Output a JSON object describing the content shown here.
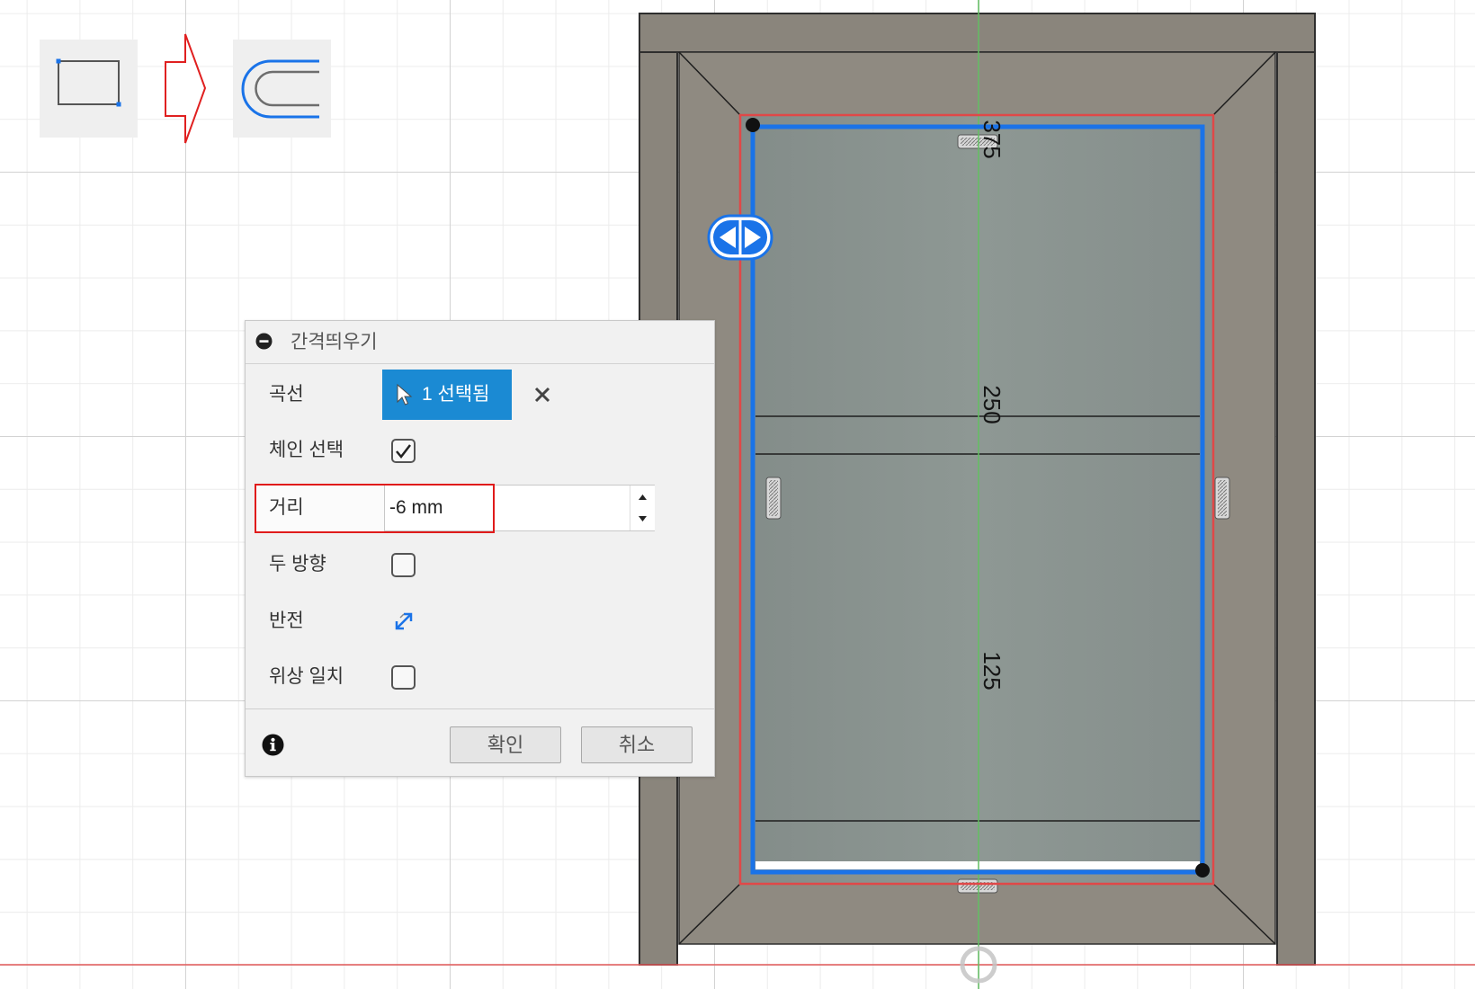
{
  "tool_sequence": {
    "from_icon": "rectangle-sketch-icon",
    "arrow_icon": "right-arrow-icon",
    "to_icon": "offset-curve-icon"
  },
  "dialog": {
    "title": "간격띄우기",
    "collapse_icon": "collapse-minus-icon",
    "curve": {
      "label": "곡선",
      "selection": "1 선택됨",
      "cursor_icon": "select-cursor-icon",
      "clear_icon": "close-icon"
    },
    "chain_select": {
      "label": "체인 선택",
      "checked": true
    },
    "distance": {
      "label": "거리",
      "value": "-6 mm"
    },
    "both_directions": {
      "label": "두 방향",
      "checked": false
    },
    "flip": {
      "label": "반전",
      "icon": "flip-direction-icon"
    },
    "topology_match": {
      "label": "위상 일치",
      "checked": false
    },
    "info_icon": "info-icon",
    "ok_label": "확인",
    "cancel_label": "취소"
  },
  "sketch": {
    "dimensions": {
      "top": "375",
      "middle": "250",
      "bottom": "125"
    },
    "handle_icon": "offset-drag-handle-icon"
  },
  "colors": {
    "accent": "#1a73e8",
    "selection_button": "#1b8ad3",
    "highlight_box": "#e01b1b",
    "profile_line": "#e04848",
    "x_axis": "#e35a5a",
    "y_axis": "#62bf62"
  }
}
